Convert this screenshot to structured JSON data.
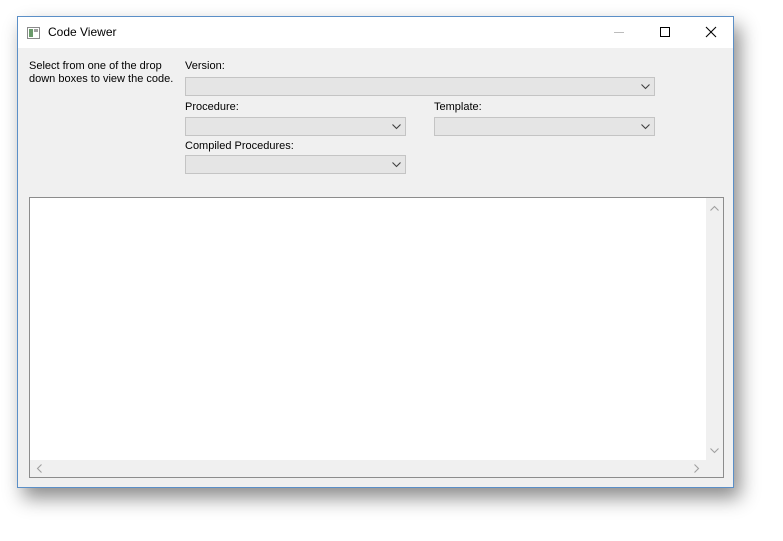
{
  "window": {
    "title": "Code Viewer"
  },
  "form": {
    "instruction": "Select from one of the drop down boxes to view the code.",
    "version_label": "Version:",
    "version_value": "",
    "procedure_label": "Procedure:",
    "procedure_value": "",
    "template_label": "Template:",
    "template_value": "",
    "compiled_label": "Compiled Procedures:",
    "compiled_value": ""
  },
  "code": {
    "content": ""
  },
  "icons": {
    "app": "window-app-icon",
    "minimize": "minimize-icon",
    "maximize": "maximize-icon",
    "close": "close-icon",
    "dropdown": "chevron-down-icon",
    "scroll_up": "chevron-up-icon",
    "scroll_down": "chevron-down-icon",
    "scroll_left": "chevron-left-icon",
    "scroll_right": "chevron-right-icon"
  },
  "colors": {
    "window_border": "#5b8fc7",
    "client_background": "#f0f0f0",
    "combo_background": "#e5e5e5"
  }
}
